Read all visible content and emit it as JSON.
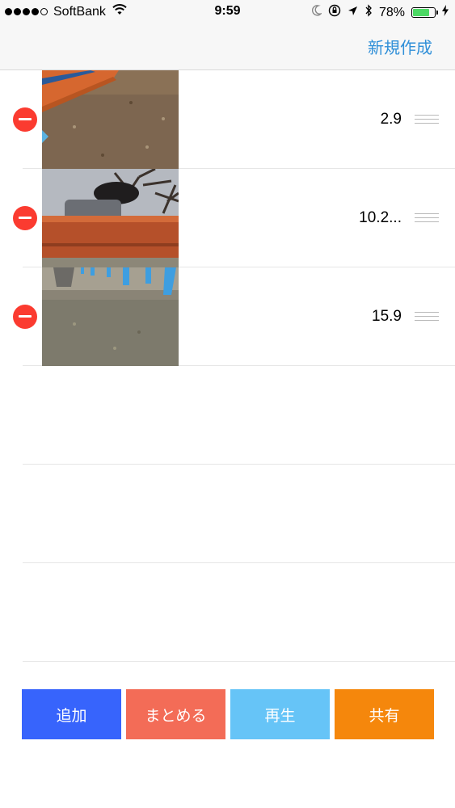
{
  "status_bar": {
    "carrier": "SoftBank",
    "time": "9:59",
    "battery": "78%",
    "battery_level": 0.78,
    "icons": [
      "signal-dots",
      "wifi-icon",
      "moon-icon",
      "orientation-lock-icon",
      "location-arrow-icon",
      "bluetooth-icon",
      "battery-icon",
      "charging-bolt-icon"
    ]
  },
  "nav": {
    "new_label": "新規作成"
  },
  "clips": [
    {
      "duration": "2.9"
    },
    {
      "duration": "10.2..."
    },
    {
      "duration": "15.9"
    }
  ],
  "toolbar": {
    "add": {
      "label": "追加",
      "color": "#3764fc"
    },
    "merge": {
      "label": "まとめる",
      "color": "#f36c57"
    },
    "play": {
      "label": "再生",
      "color": "#66c4f7"
    },
    "share": {
      "label": "共有",
      "color": "#f5870c"
    }
  },
  "colors": {
    "accent": "#2f8fd8",
    "delete": "#fb3b30",
    "battery": "#4cd964"
  }
}
